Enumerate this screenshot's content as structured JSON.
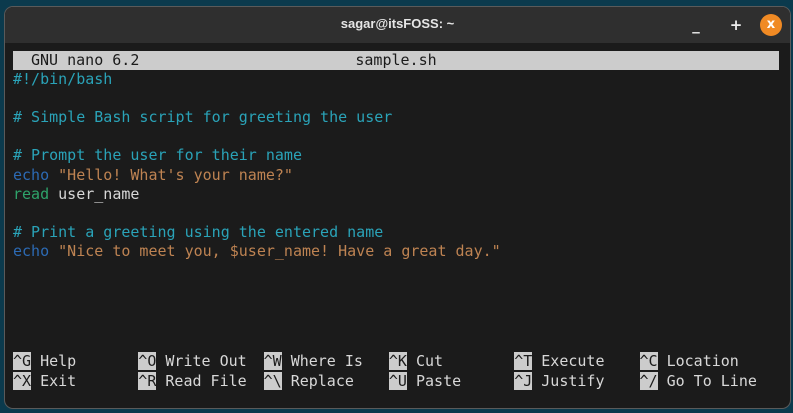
{
  "window": {
    "title": "sagar@itsFOSS: ~",
    "minimize": "_",
    "maximize": "+",
    "close": "x"
  },
  "nano": {
    "version": "GNU nano 6.2",
    "filename": "sample.sh"
  },
  "lines": [
    [
      {
        "t": "#!/bin/bash",
        "c": "cm"
      }
    ],
    [],
    [
      {
        "t": "# Simple Bash script for greeting the user",
        "c": "cm"
      }
    ],
    [],
    [
      {
        "t": "# Prompt the user for their name",
        "c": "cm"
      }
    ],
    [
      {
        "t": "echo",
        "c": "kw"
      },
      {
        "t": " ",
        "c": "pl"
      },
      {
        "t": "\"Hello! What's your name?\"",
        "c": "st"
      }
    ],
    [
      {
        "t": "read",
        "c": "rd"
      },
      {
        "t": " user_name",
        "c": "pl"
      }
    ],
    [],
    [
      {
        "t": "# Print a greeting using the entered name",
        "c": "cm"
      }
    ],
    [
      {
        "t": "echo",
        "c": "kw"
      },
      {
        "t": " ",
        "c": "pl"
      },
      {
        "t": "\"Nice to meet you, $user_name! Have a great day.\"",
        "c": "st"
      }
    ]
  ],
  "shortcuts": [
    [
      {
        "k": "^G",
        "l": "Help"
      },
      {
        "k": "^O",
        "l": "Write Out"
      },
      {
        "k": "^W",
        "l": "Where Is"
      },
      {
        "k": "^K",
        "l": "Cut"
      },
      {
        "k": "^T",
        "l": "Execute"
      },
      {
        "k": "^C",
        "l": "Location"
      }
    ],
    [
      {
        "k": "^X",
        "l": "Exit"
      },
      {
        "k": "^R",
        "l": "Read File"
      },
      {
        "k": "^\\",
        "l": "Replace"
      },
      {
        "k": "^U",
        "l": "Paste"
      },
      {
        "k": "^J",
        "l": "Justify"
      },
      {
        "k": "^/",
        "l": "Go To Line"
      }
    ]
  ]
}
